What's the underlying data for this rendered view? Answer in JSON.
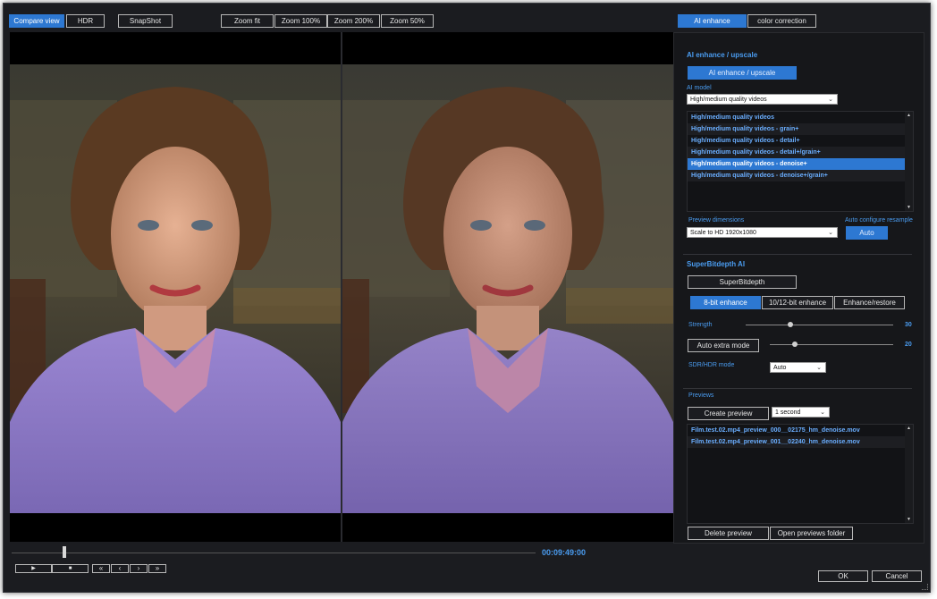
{
  "toolbar": {
    "compare_view": "Compare view",
    "hdr": "HDR",
    "snapshot": "SnapShot",
    "zoom_fit": "Zoom fit",
    "zoom_100": "Zoom 100%",
    "zoom_200": "Zoom 200%",
    "zoom_50": "Zoom 50%"
  },
  "tabs": {
    "ai_enhance": "AI enhance",
    "color_correction": "color correction"
  },
  "ai": {
    "section_title": "AI enhance / upscale",
    "button": "AI enhance / upscale",
    "model_label": "AI model",
    "model_value": "High/medium quality videos",
    "models": [
      "High/medium quality videos",
      "High/medium quality videos - grain+",
      "High/medium quality videos - detail+",
      "High/medium quality videos - detail+/grain+",
      "High/medium quality videos - denoise+",
      "High/medium quality videos - denoise+/grain+"
    ],
    "selected_index": 4,
    "preview_dim_label": "Preview dimensions",
    "preview_dim_value": "Scale to HD 1920x1080",
    "auto_config_label": "Auto configure resample",
    "auto_button": "Auto"
  },
  "superbit": {
    "title": "SuperBitdepth AI",
    "button": "SuperBitdepth",
    "tab_8bit": "8-bit enhance",
    "tab_10bit": "10/12-bit enhance",
    "tab_restore": "Enhance/restore",
    "strength_label": "Strength",
    "strength_value": "30",
    "strength_level": 0.3,
    "auto_extra_button": "Auto extra mode",
    "auto_extra_value": "20",
    "auto_extra_level": 0.2,
    "sdr_label": "SDR/HDR mode",
    "sdr_value": "Auto"
  },
  "previews": {
    "title": "Previews",
    "create_button": "Create preview",
    "duration_value": "1 second",
    "items": [
      "Film.test.02.mp4_preview_000__02175_hm_denoise.mov",
      "Film.test.02.mp4_preview_001__02240_hm_denoise.mov"
    ],
    "delete_button": "Delete preview",
    "open_folder_button": "Open previews folder"
  },
  "transport": {
    "timecode": "00:09:49:00",
    "position": 0.1,
    "play": "▶",
    "stop": "■",
    "rewind": "«",
    "step_back": "‹",
    "step_forward": "›",
    "fast_forward": "»"
  },
  "dialog": {
    "ok": "OK",
    "cancel": "Cancel"
  },
  "colors": {
    "accent": "#2d78d2",
    "label": "#4a9cf0",
    "background": "#1b1c20"
  }
}
